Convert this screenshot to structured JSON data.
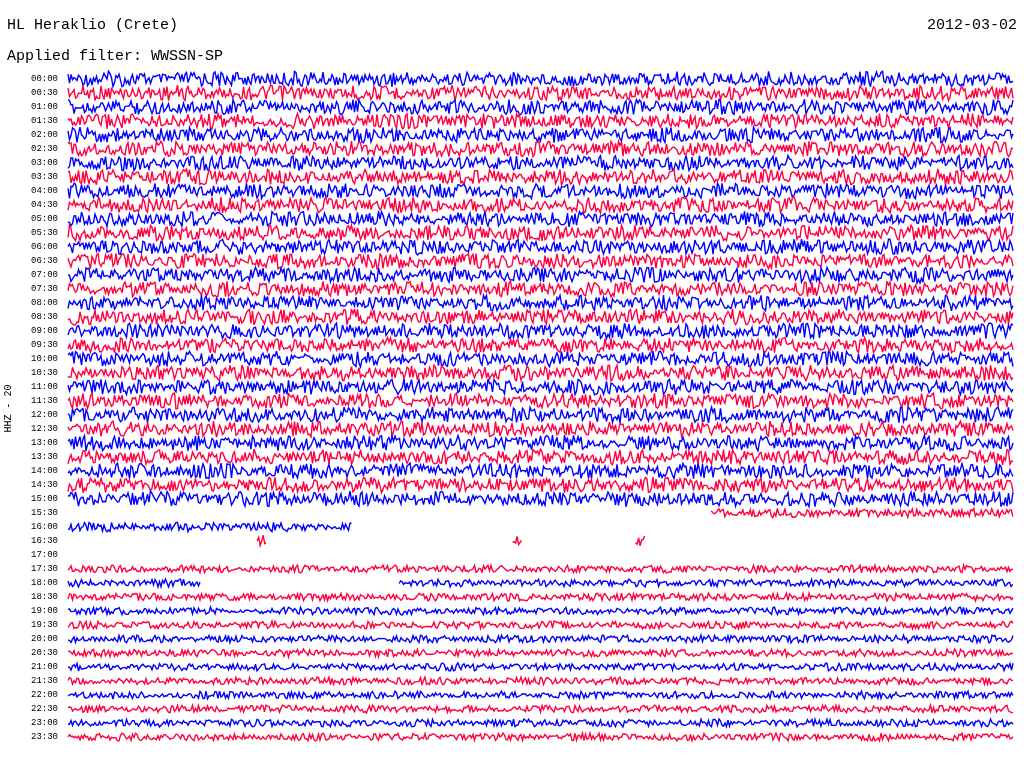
{
  "header": {
    "station": "HL Heraklio (Crete)",
    "date": "2012-03-02",
    "filter": "Applied filter: WWSSN-SP"
  },
  "axis_label": "HHZ - 20",
  "rows": [
    {
      "label": "00:00",
      "color": "#0000ff",
      "kind": "strong"
    },
    {
      "label": "00:30",
      "color": "#ff0040",
      "kind": "strong"
    },
    {
      "label": "01:00",
      "color": "#0000ff",
      "kind": "strong"
    },
    {
      "label": "01:30",
      "color": "#ff0040",
      "kind": "strong"
    },
    {
      "label": "02:00",
      "color": "#0000ff",
      "kind": "strong"
    },
    {
      "label": "02:30",
      "color": "#ff0040",
      "kind": "strong"
    },
    {
      "label": "03:00",
      "color": "#0000ff",
      "kind": "strong"
    },
    {
      "label": "03:30",
      "color": "#ff0040",
      "kind": "strong"
    },
    {
      "label": "04:00",
      "color": "#0000ff",
      "kind": "strong"
    },
    {
      "label": "04:30",
      "color": "#ff0040",
      "kind": "strong"
    },
    {
      "label": "05:00",
      "color": "#0000ff",
      "kind": "strong"
    },
    {
      "label": "05:30",
      "color": "#ff0040",
      "kind": "strong"
    },
    {
      "label": "06:00",
      "color": "#0000ff",
      "kind": "strong"
    },
    {
      "label": "06:30",
      "color": "#ff0040",
      "kind": "strong"
    },
    {
      "label": "07:00",
      "color": "#0000ff",
      "kind": "strong"
    },
    {
      "label": "07:30",
      "color": "#ff0040",
      "kind": "strong"
    },
    {
      "label": "08:00",
      "color": "#0000ff",
      "kind": "strong"
    },
    {
      "label": "08:30",
      "color": "#ff0040",
      "kind": "strong"
    },
    {
      "label": "09:00",
      "color": "#0000ff",
      "kind": "strong"
    },
    {
      "label": "09:30",
      "color": "#ff0040",
      "kind": "strong"
    },
    {
      "label": "10:00",
      "color": "#0000ff",
      "kind": "strong"
    },
    {
      "label": "10:30",
      "color": "#ff0040",
      "kind": "strong"
    },
    {
      "label": "11:00",
      "color": "#0000ff",
      "kind": "strong"
    },
    {
      "label": "11:30",
      "color": "#ff0040",
      "kind": "strong"
    },
    {
      "label": "12:00",
      "color": "#0000ff",
      "kind": "strong"
    },
    {
      "label": "12:30",
      "color": "#ff0040",
      "kind": "strong"
    },
    {
      "label": "13:00",
      "color": "#0000ff",
      "kind": "strong"
    },
    {
      "label": "13:30",
      "color": "#ff0040",
      "kind": "strong"
    },
    {
      "label": "14:00",
      "color": "#0000ff",
      "kind": "strong"
    },
    {
      "label": "14:30",
      "color": "#ff0040",
      "kind": "strong"
    },
    {
      "label": "15:00",
      "color": "#0000ff",
      "kind": "strong"
    },
    {
      "label": "15:30",
      "color": "#ff0040",
      "kind": "late"
    },
    {
      "label": "16:00",
      "color": "#0000ff",
      "kind": "early"
    },
    {
      "label": "16:30",
      "color": "#ff0040",
      "kind": "sparse"
    },
    {
      "label": "17:00",
      "kind": "empty"
    },
    {
      "label": "17:30",
      "color": "#ff0040",
      "kind": "weak"
    },
    {
      "label": "18:00",
      "color": "#0000ff",
      "kind": "split"
    },
    {
      "label": "18:30",
      "color": "#ff0040",
      "kind": "weak"
    },
    {
      "label": "19:00",
      "color": "#0000ff",
      "kind": "weak"
    },
    {
      "label": "19:30",
      "color": "#ff0040",
      "kind": "weak"
    },
    {
      "label": "20:00",
      "color": "#0000ff",
      "kind": "weak"
    },
    {
      "label": "20:30",
      "color": "#ff0040",
      "kind": "weak"
    },
    {
      "label": "21:00",
      "color": "#0000ff",
      "kind": "weak"
    },
    {
      "label": "21:30",
      "color": "#ff0040",
      "kind": "weak"
    },
    {
      "label": "22:00",
      "color": "#0000ff",
      "kind": "weak"
    },
    {
      "label": "22:30",
      "color": "#ff0040",
      "kind": "weak"
    },
    {
      "label": "23:00",
      "color": "#0000ff",
      "kind": "weak"
    },
    {
      "label": "23:30",
      "color": "#ff0040",
      "kind": "weak"
    }
  ]
}
